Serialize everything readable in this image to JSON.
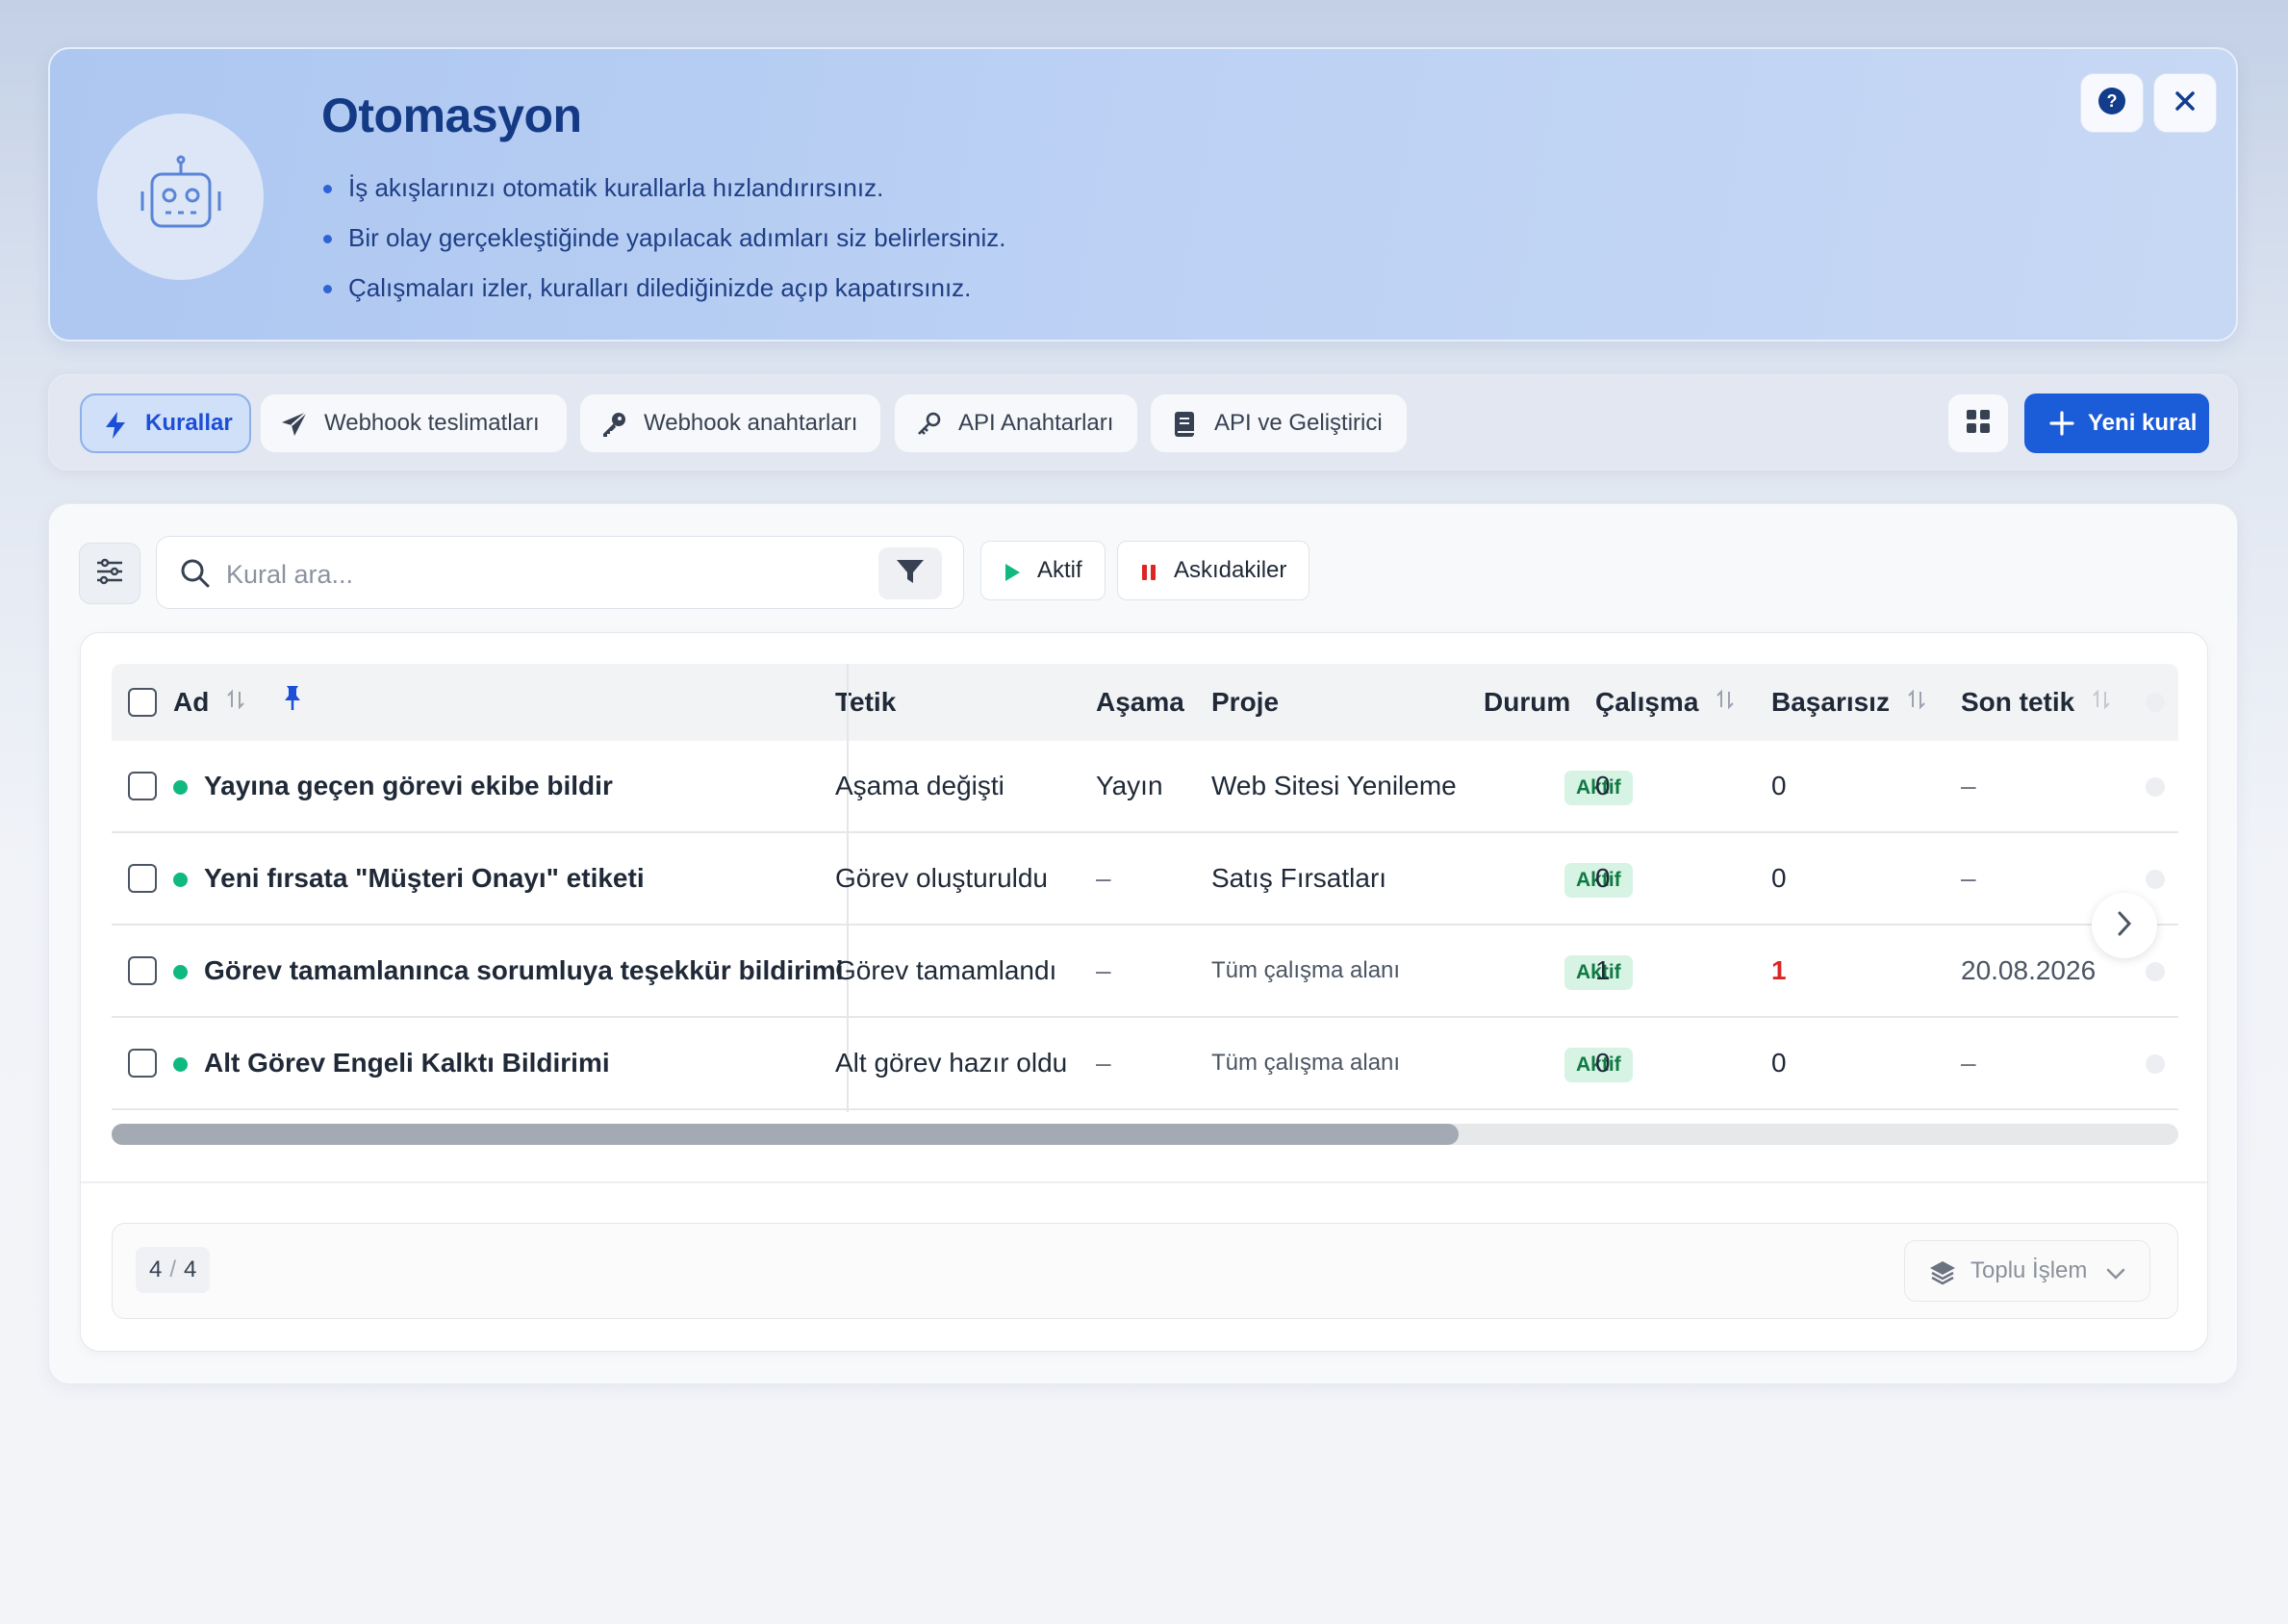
{
  "hero": {
    "title": "Otomasyon",
    "bullets": [
      "İş akışlarınızı otomatik kurallarla hızlandırırsınız.",
      "Bir olay gerçekleştiğinde yapılacak adımları siz belirlersiniz.",
      "Çalışmaları izler, kuralları dilediğinizde açıp kapatırsınız."
    ],
    "avatar_icon": "robot-icon",
    "help_icon": "help-icon",
    "close_icon": "close-icon"
  },
  "tabs": [
    {
      "label": "Kurallar",
      "icon": "bolt-icon",
      "active": true
    },
    {
      "label": "Webhook teslimatları",
      "icon": "paper-plane-icon",
      "active": false
    },
    {
      "label": "Webhook anahtarları",
      "icon": "key-icon",
      "active": false
    },
    {
      "label": "API Anahtarları",
      "icon": "key-outline-icon",
      "active": false
    },
    {
      "label": "API ve Geliştirici",
      "icon": "book-icon",
      "active": false
    }
  ],
  "toolbar": {
    "new_rule_label": "Yeni kural",
    "grid_icon": "grid-icon"
  },
  "search": {
    "placeholder": "Kural ara...",
    "value": ""
  },
  "filters": {
    "active_label": "Aktif",
    "suspended_label": "Askıdakiler"
  },
  "table": {
    "columns": {
      "name": "Ad",
      "trigger": "Tetik",
      "stage": "Aşama",
      "project": "Proje",
      "status": "Durum",
      "runs": "Çalışma",
      "failed": "Başarısız",
      "last_trigger": "Son tetik"
    },
    "rows": [
      {
        "name": "Yayına geçen görevi ekibe bildir",
        "trigger": "Aşama değişti",
        "stage": "Yayın",
        "project": "Web Sitesi Yenileme",
        "project_muted": false,
        "status": "Aktif",
        "runs": "0",
        "failed": "0",
        "failed_alert": false,
        "last": "–"
      },
      {
        "name": "Yeni fırsata \"Müşteri Onayı\" etiketi",
        "trigger": "Görev oluşturuldu",
        "stage": "–",
        "project": "Satış Fırsatları",
        "project_muted": false,
        "status": "Aktif",
        "runs": "0",
        "failed": "0",
        "failed_alert": false,
        "last": "–"
      },
      {
        "name": "Görev tamamlanınca sorumluya teşekkür bildirimi",
        "trigger": "Görev tamamlandı",
        "stage": "–",
        "project": "Tüm çalışma alanı",
        "project_muted": true,
        "status": "Aktif",
        "runs": "1",
        "failed": "1",
        "failed_alert": true,
        "last": "20.08.2026"
      },
      {
        "name": "Alt Görev Engeli Kalktı Bildirimi",
        "trigger": "Alt görev hazır oldu",
        "stage": "–",
        "project": "Tüm çalışma alanı",
        "project_muted": true,
        "status": "Aktif",
        "runs": "0",
        "failed": "0",
        "failed_alert": false,
        "last": "–"
      }
    ]
  },
  "footer": {
    "shown": "4",
    "total": "4",
    "bulk_label": "Toplu İşlem"
  },
  "colors": {
    "accent": "#1b5cd8",
    "success": "#10b981",
    "danger": "#dc2626",
    "hero_title": "#143a86"
  }
}
